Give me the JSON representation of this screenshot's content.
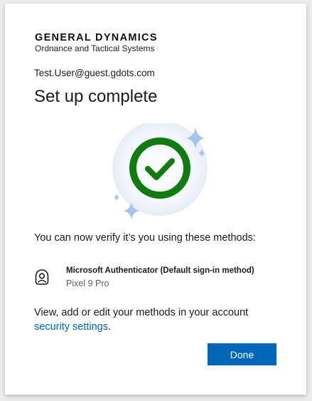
{
  "brand": {
    "name": "GENERAL DYNAMICS",
    "division": "Ordnance and Tactical Systems"
  },
  "account": {
    "email": "Test.User@guest.gdots.com"
  },
  "page": {
    "title": "Set up complete",
    "status_icon": "success-checkmark-icon",
    "verify_text": "You can now verify it’s you using these methods:"
  },
  "method": {
    "icon": "authenticator-app-icon",
    "name": "Microsoft Authenticator (Default sign-in method)",
    "device": "Pixel 9 Pro"
  },
  "manage": {
    "text": "View, add or edit your methods in your account ",
    "link": "security settings",
    "suffix": "."
  },
  "actions": {
    "done_label": "Done"
  },
  "colors": {
    "accent": "#0067b8",
    "success": "#107c10",
    "sparkle": "#a8c4ec"
  }
}
